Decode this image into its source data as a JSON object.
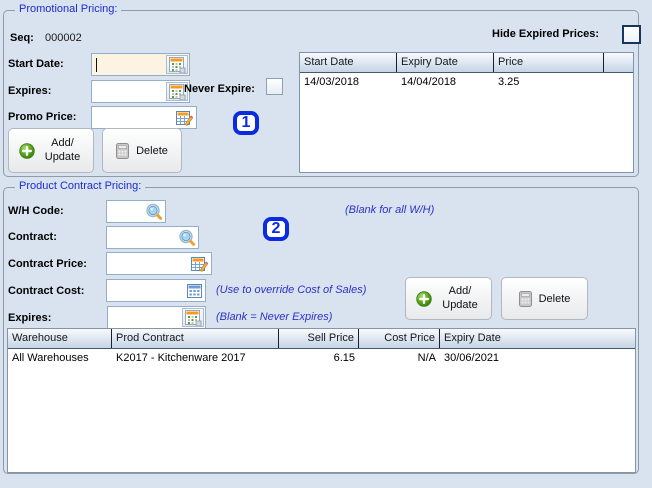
{
  "colors": {
    "page_bg": "#d9e3f0",
    "title_blue": "#1d2ccd",
    "hint_blue": "#2a32c8",
    "marker_blue": "#0b2be0",
    "focused_field_bg": "#fcf3e2"
  },
  "promo": {
    "title": "Promotional Pricing:",
    "seq_label": "Seq:",
    "seq_value": "000002",
    "start_date_label": "Start Date:",
    "start_date_value": "",
    "start_date_icon": "calendar-icon",
    "expires_label": "Expires:",
    "expires_value": "",
    "expires_icon": "calendar-icon",
    "never_expire_label": "Never Expire:",
    "never_expire_checked": false,
    "promo_price_label": "Promo Price:",
    "promo_price_value": "",
    "promo_price_icon": "price-edit-icon",
    "add_update_label": "Add/ Update",
    "add_update_icon": "green-plus-icon",
    "delete_label": "Delete",
    "delete_icon": "gray-calculator-icon",
    "marker": "1",
    "hide_expired_label": "Hide Expired Prices:",
    "hide_expired_checked": false,
    "table": {
      "headers": [
        "Start Date",
        "Expiry Date",
        "Price"
      ],
      "rows": [
        {
          "start": "14/03/2018",
          "expiry": "14/04/2018",
          "price": "3.25"
        }
      ]
    }
  },
  "contract": {
    "title": "Product Contract Pricing:",
    "wh_code_label": "W/H Code:",
    "wh_code_value": "",
    "wh_code_icon": "search-icon",
    "wh_hint": "(Blank for all W/H)",
    "contract_label": "Contract:",
    "contract_value": "",
    "contract_icon": "search-icon",
    "price_label": "Contract Price:",
    "price_value": "",
    "price_icon": "price-edit-icon",
    "cost_label": "Contract Cost:",
    "cost_value": "",
    "cost_icon": "calculator-icon",
    "cost_hint": "(Use to override Cost of Sales)",
    "expires_label": "Expires:",
    "expires_value": "",
    "expires_icon": "calendar-icon",
    "expires_hint": "(Blank = Never Expires)",
    "add_update_label": "Add/ Update",
    "add_update_icon": "green-plus-icon",
    "delete_label": "Delete",
    "delete_icon": "gray-calculator-icon",
    "marker": "2",
    "table": {
      "headers": [
        "Warehouse",
        "Prod Contract",
        "Sell Price",
        "Cost Price",
        "Expiry Date"
      ],
      "rows": [
        {
          "warehouse": "All Warehouses",
          "prod_contract": "K2017  - Kitchenware 2017",
          "sell_price": "6.15",
          "cost_price": "N/A",
          "expiry_date": "30/06/2021"
        }
      ]
    }
  }
}
